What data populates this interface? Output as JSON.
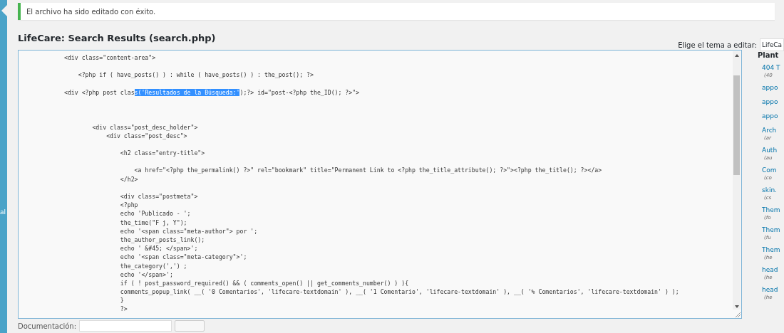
{
  "sidebar": {
    "label": "al"
  },
  "notice": {
    "text": "El archivo ha sido editado con éxito."
  },
  "title": "LifeCare: Search Results (search.php)",
  "theme_picker": {
    "label": "Elige el tema a editar:",
    "value": "LifeCa"
  },
  "editor": {
    "lines": [
      {
        "kind": "plain",
        "text": "<div class=\"content-area\">"
      },
      {
        "kind": "blank"
      },
      {
        "kind": "plain",
        "text": "    <?php if ( have_posts() ) : while ( have_posts() ) : the_post(); ?>"
      },
      {
        "kind": "blank"
      },
      {
        "kind": "rich",
        "segments": [
          {
            "text": "<div <?php post clas",
            "selected": false
          },
          {
            "text": "s('Resultados de la Búsqueda:'",
            "selected": true
          },
          {
            "text": ");?> id=\"post-<?php the_ID(); ?>\">",
            "selected": false
          }
        ]
      },
      {
        "kind": "blank"
      },
      {
        "kind": "blank"
      },
      {
        "kind": "blank"
      },
      {
        "kind": "plain",
        "text": "        <div class=\"post_desc_holder\">"
      },
      {
        "kind": "plain",
        "text": "            <div class=\"post_desc\">"
      },
      {
        "kind": "blank"
      },
      {
        "kind": "plain",
        "text": "                <h2 class=\"entry-title\">"
      },
      {
        "kind": "blank"
      },
      {
        "kind": "plain",
        "text": "                    <a href=\"<?php the_permalink() ?>\" rel=\"bookmark\" title=\"Permanent Link to <?php the_title_attribute(); ?>\"><?php the_title(); ?></a>"
      },
      {
        "kind": "plain",
        "text": "                </h2>"
      },
      {
        "kind": "blank"
      },
      {
        "kind": "plain",
        "text": "                <div class=\"postmeta\">"
      },
      {
        "kind": "plain",
        "text": "                <?php"
      },
      {
        "kind": "plain",
        "text": "                echo 'Publicado - ';"
      },
      {
        "kind": "plain",
        "text": "                the_time(\"F j, Y\");"
      },
      {
        "kind": "plain",
        "text": "                echo '<span class=\"meta-author\"> por ';"
      },
      {
        "kind": "plain",
        "text": "                the_author_posts_link();"
      },
      {
        "kind": "plain",
        "text": "                echo ' &#45; </span>';"
      },
      {
        "kind": "plain",
        "text": "                echo '<span class=\"meta-category\">';"
      },
      {
        "kind": "plain",
        "text": "                the_category(',') ;"
      },
      {
        "kind": "plain",
        "text": "                echo '</span>';"
      },
      {
        "kind": "plain",
        "text": "                if ( ! post_password_required() && ( comments_open() || get_comments_number() ) ){"
      },
      {
        "kind": "plain",
        "text": "                comments_popup_link( __( '0 Comentarios', 'lifecare-textdomain' ), __( '1 Comentario', 'lifecare-textdomain' ), __( '% Comentarios', 'lifecare-textdomain' ) );"
      },
      {
        "kind": "plain",
        "text": "                }"
      },
      {
        "kind": "plain",
        "text": "                ?>"
      }
    ]
  },
  "templates": {
    "heading": "Plant",
    "items": [
      {
        "name": "404 T",
        "file": "(40"
      },
      {
        "name": "appo"
      },
      {
        "name": "appo"
      },
      {
        "name": "appo"
      },
      {
        "name": "Arch",
        "file": "(ar"
      },
      {
        "name": "Auth",
        "file": "(au"
      },
      {
        "name": "Com",
        "file": "(co"
      },
      {
        "name": "skin.",
        "file": "(cs"
      },
      {
        "name": "Them",
        "file": "(fo"
      },
      {
        "name": "Them",
        "file": "(fu"
      },
      {
        "name": "Them",
        "file": "(he"
      },
      {
        "name": "head",
        "file": "(he"
      },
      {
        "name": "head",
        "file": "(he"
      }
    ]
  },
  "documentation": {
    "label": "Documentación:"
  }
}
